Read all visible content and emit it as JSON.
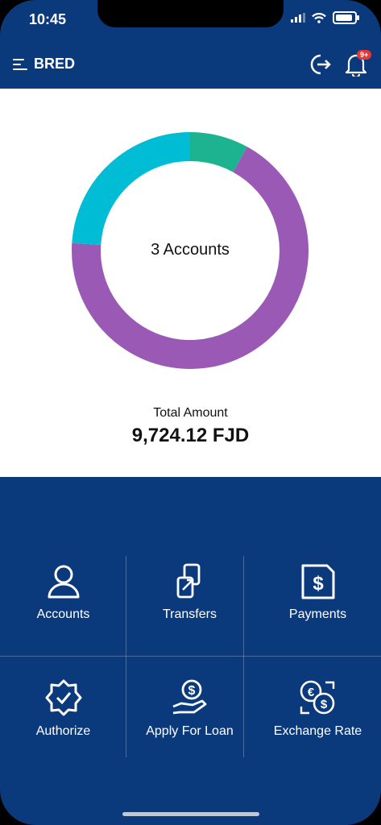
{
  "status": {
    "time": "10:45"
  },
  "header": {
    "title": "BRED",
    "notification_badge": "9+"
  },
  "summary": {
    "center_label": "3 Accounts",
    "total_label": "Total Amount",
    "total_value": "9,724.12 FJD"
  },
  "chart_data": {
    "type": "pie",
    "values": [
      8,
      68,
      24
    ],
    "colors": [
      "#1db390",
      "#9b59b6",
      "#00bcd4"
    ]
  },
  "tiles": [
    {
      "label": "Accounts",
      "icon": "user-icon"
    },
    {
      "label": "Transfers",
      "icon": "transfer-icon"
    },
    {
      "label": "Payments",
      "icon": "dollar-document-icon"
    },
    {
      "label": "Authorize",
      "icon": "verified-badge-icon"
    },
    {
      "label": "Apply For Loan",
      "icon": "hand-coin-icon"
    },
    {
      "label": "Exchange Rate",
      "icon": "currency-exchange-icon"
    }
  ],
  "colors": {
    "primary": "#0b3a7c"
  }
}
